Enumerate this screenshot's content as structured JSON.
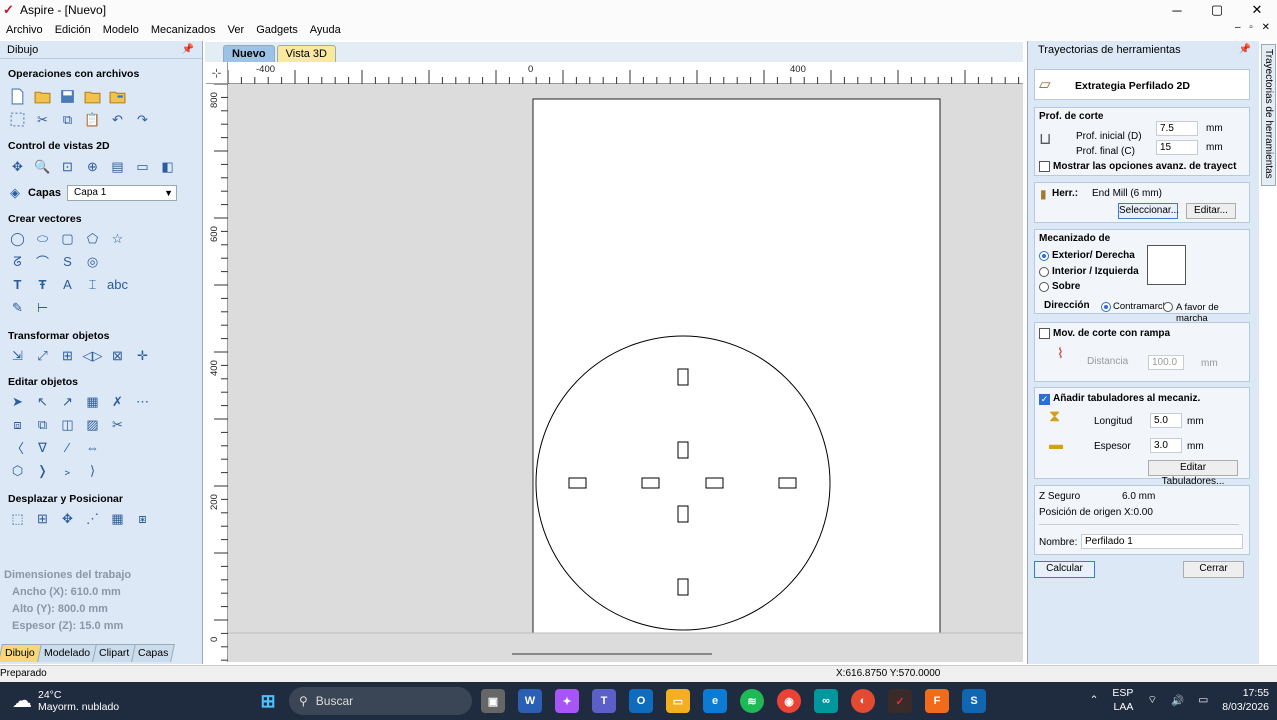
{
  "window": {
    "title": "Aspire - [Nuevo]",
    "min": "─",
    "max": "▢",
    "close": "✕"
  },
  "menu": [
    "Archivo",
    "Edición",
    "Modelo",
    "Mecanizados",
    "Ver",
    "Gadgets",
    "Ayuda"
  ],
  "left_panel": {
    "header": "Dibujo",
    "sections": {
      "archivos": "Operaciones con archivos",
      "vistas": "Control de vistas 2D",
      "capas_label": "Capas",
      "capa_value": "Capa 1",
      "vectores": "Crear vectores",
      "transformar": "Transformar objetos",
      "editar": "Editar objetos",
      "desplazar": "Desplazar y Posicionar"
    },
    "dims": {
      "title": "Dimensiones del trabajo",
      "ancho": "Ancho  (X): 610.0 mm",
      "alto": "Alto   (Y): 800.0 mm",
      "espesor": "Espesor (Z): 15.0 mm"
    },
    "tabs": [
      "Dibujo",
      "Modelado",
      "Clipart",
      "Capas"
    ]
  },
  "doc_tabs": [
    "Nuevo",
    "Vista 3D"
  ],
  "ruler": {
    "top": [
      "-400",
      "0",
      "400"
    ],
    "left": [
      "800",
      "600",
      "400",
      "200",
      "0"
    ]
  },
  "status": {
    "left": "Preparado",
    "coords": "X:616.8750 Y:570.0000"
  },
  "right_panel": {
    "header": "Trayectorias de herramientas",
    "strategy": "Extrategia Perfilado 2D",
    "prof": {
      "title": "Prof. de corte",
      "inicial_label": "Prof. inicial (D)",
      "inicial": "7.5",
      "final_label": "Prof. final (C)",
      "final": "15",
      "unit": "mm",
      "advanced": "Mostrar las opciones avanz. de trayect"
    },
    "herr": {
      "label": "Herr.:",
      "value": "End Mill (6 mm)",
      "select": "Seleccionar...",
      "edit": "Editar..."
    },
    "mec": {
      "title": "Mecanizado de",
      "o1": "Exterior/ Derecha",
      "o2": "Interior / Izquierda",
      "o3": "Sobre",
      "dir_label": "Dirección",
      "d1": "Contramarcha",
      "d2": "A favor de marcha"
    },
    "rampa": {
      "label": "Mov. de corte con rampa",
      "dist_label": "Distancia",
      "dist": "100.0",
      "unit": "mm"
    },
    "tabs": {
      "label": "Añadir tabuladores al mecaniz.",
      "long_label": "Longitud",
      "long": "5.0",
      "esp_label": "Espesor",
      "esp": "3.0",
      "unit": "mm",
      "edit": "Editar Tabuladores..."
    },
    "info": {
      "z_label": "Z Seguro",
      "z": "6.0 mm",
      "pos_label": "Posición de origen",
      "pos": "X:0.00",
      "name_label": "Nombre:",
      "name": "Perfilado 1"
    },
    "calc": "Calcular",
    "close": "Cerrar"
  },
  "side_tab": "Trayectorias de herramientas",
  "taskbar": {
    "temp": "24°C",
    "weather": "Mayorm. nublado",
    "search": "Buscar",
    "lang1": "ESP",
    "lang2": "LAA",
    "time": "17:55",
    "date": "8/03/2026"
  }
}
